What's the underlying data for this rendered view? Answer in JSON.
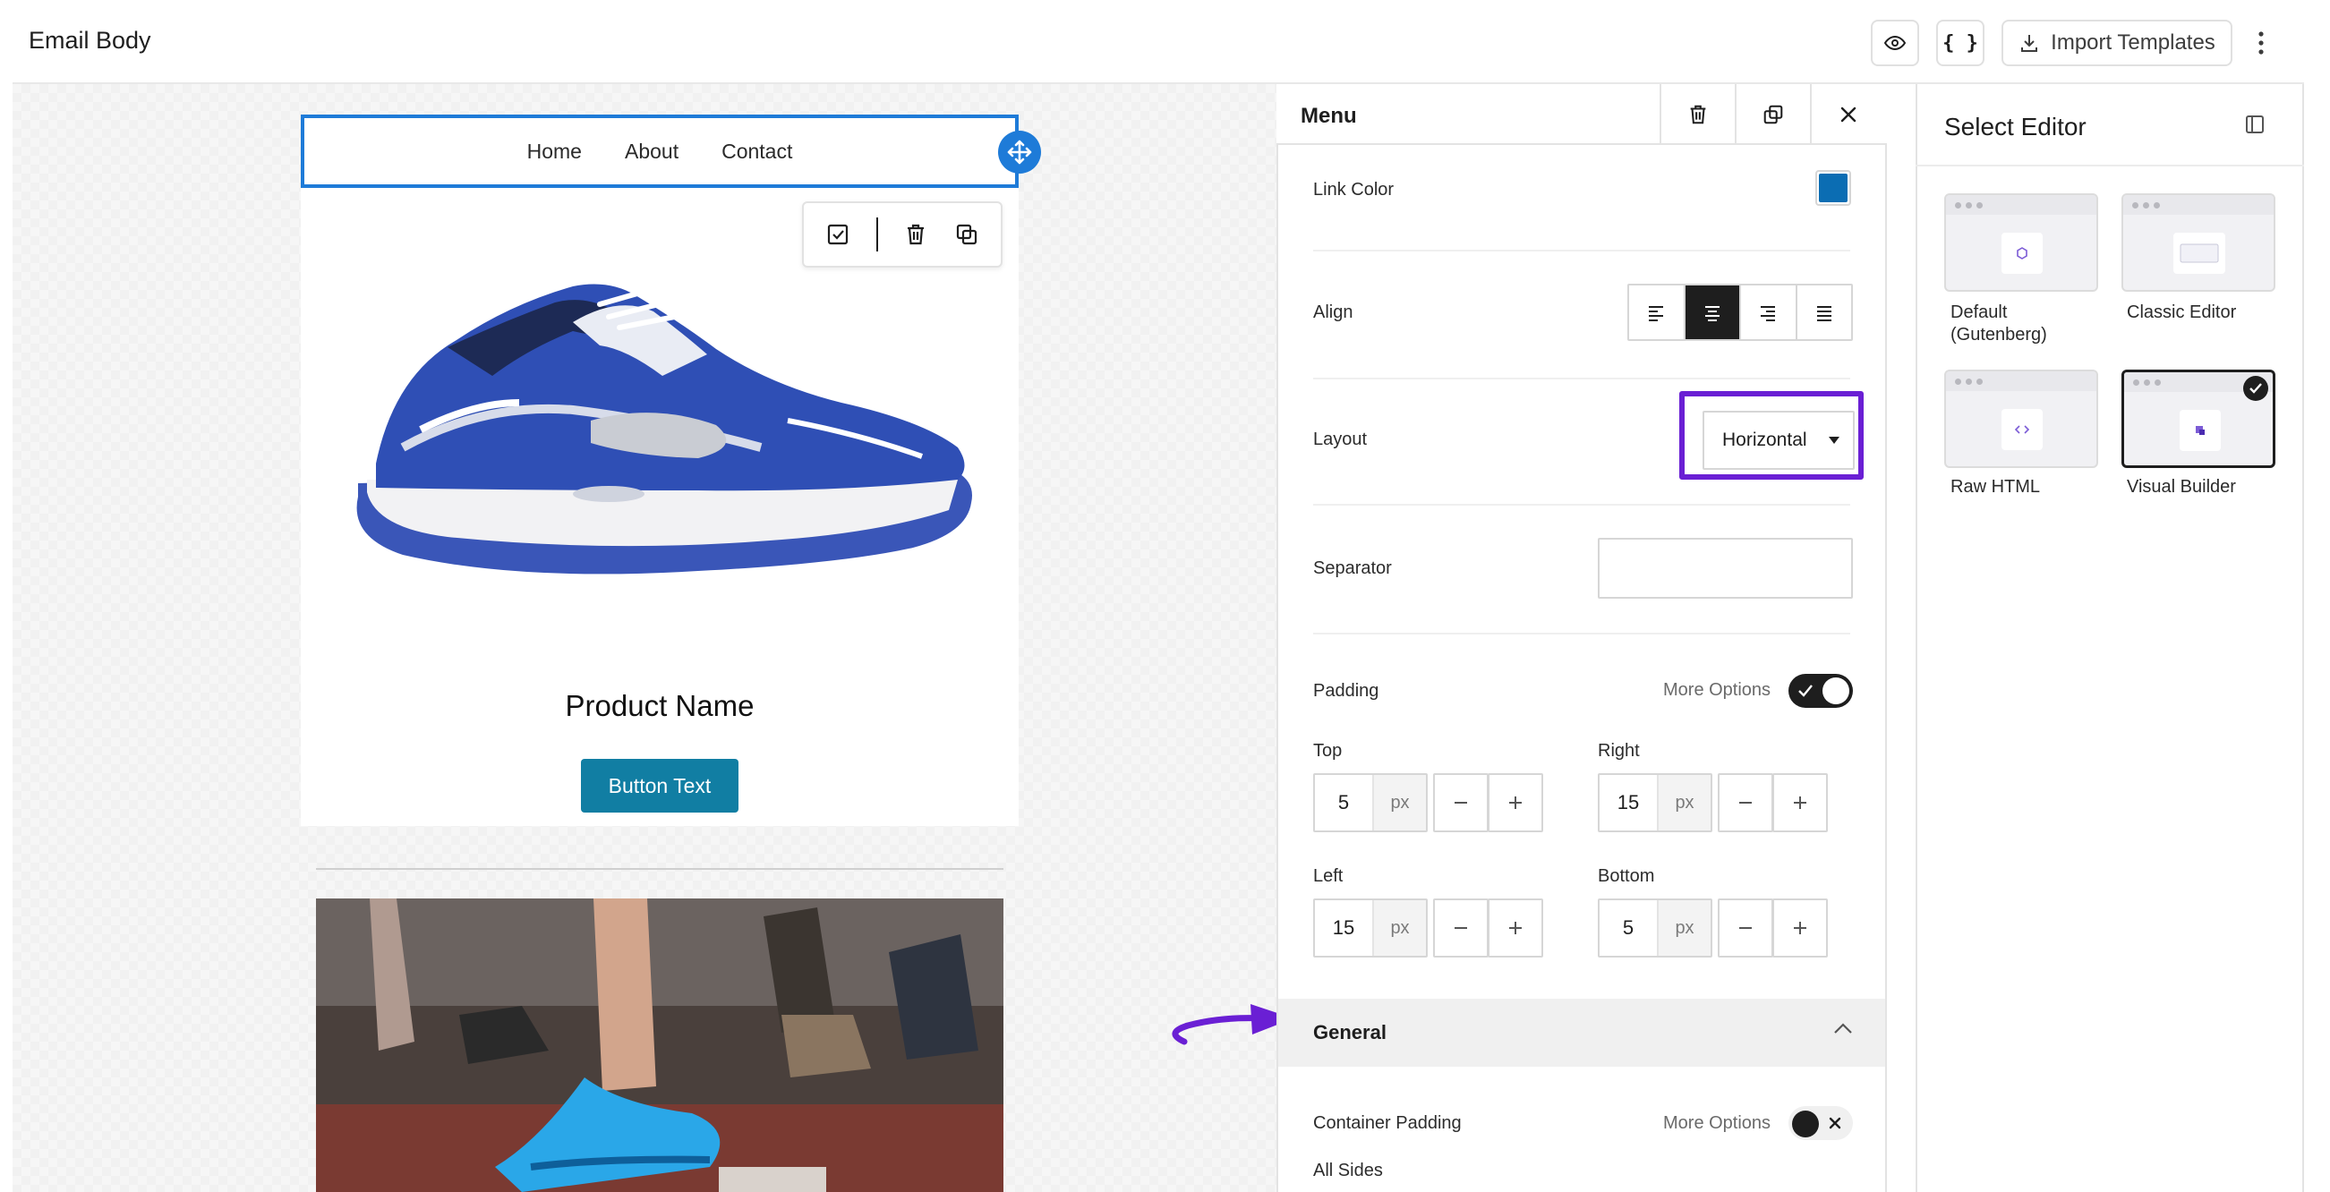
{
  "topbar": {
    "title": "Email Body",
    "import_label": "Import Templates",
    "code_label": "{ }"
  },
  "canvas": {
    "menu_items": [
      "Home",
      "About",
      "Contact"
    ],
    "product_name": "Product Name",
    "button_text": "Button Text",
    "button_color": "#117ea3"
  },
  "panel": {
    "title": "Menu",
    "link_color_label": "Link Color",
    "link_color": "#0b6db3",
    "align_label": "Align",
    "align_selected": "center",
    "layout_label": "Layout",
    "layout_value": "Horizontal",
    "separator_label": "Separator",
    "separator_value": "",
    "padding_label": "Padding",
    "more_options": "More Options",
    "padding": {
      "top_label": "Top",
      "top_value": "5",
      "right_label": "Right",
      "right_value": "15",
      "left_label": "Left",
      "left_value": "15",
      "bottom_label": "Bottom",
      "bottom_value": "5",
      "unit": "px"
    },
    "general_label": "General",
    "container_padding_label": "Container Padding",
    "all_sides_label": "All Sides"
  },
  "editor": {
    "title": "Select Editor",
    "options": [
      {
        "label_line1": "Default",
        "label_line2": "(Gutenberg)"
      },
      {
        "label_line1": "Classic Editor"
      },
      {
        "label_line1": "Raw HTML"
      },
      {
        "label_line1": "Visual Builder",
        "selected": true
      }
    ]
  },
  "annotation_color": "#6a1fd4"
}
